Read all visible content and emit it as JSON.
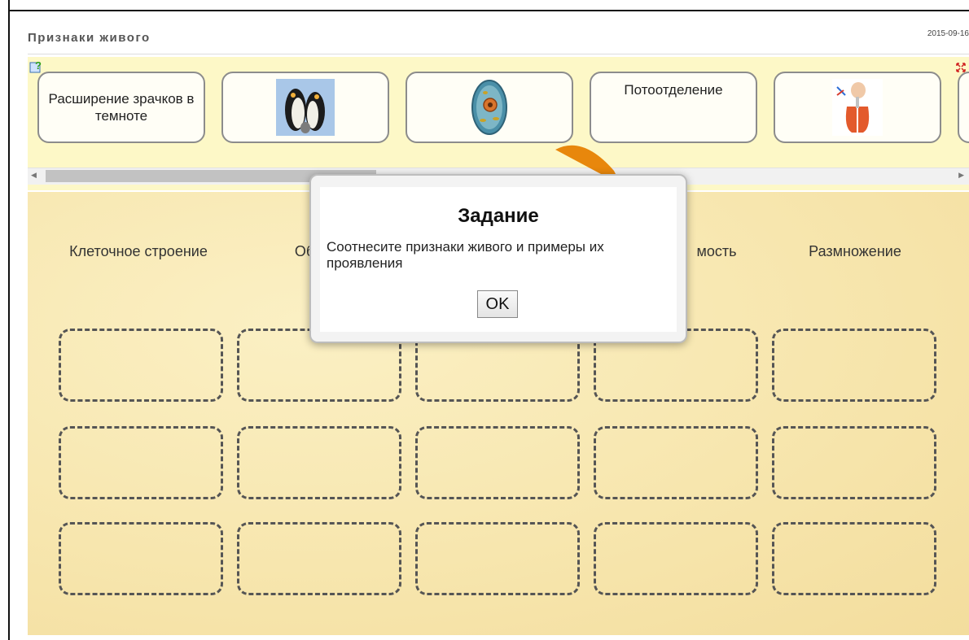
{
  "header": {
    "title": "Признаки живого",
    "date": "2015-09-16"
  },
  "tray": {
    "cards": [
      {
        "kind": "text",
        "label": "Расширение зрачков в темноте",
        "icon": ""
      },
      {
        "kind": "image",
        "label": "",
        "icon": "penguins-image"
      },
      {
        "kind": "image",
        "label": "",
        "icon": "cell-image"
      },
      {
        "kind": "text",
        "label": "Потоотделение",
        "icon": ""
      },
      {
        "kind": "image",
        "label": "",
        "icon": "lungs-image"
      }
    ]
  },
  "board": {
    "categories": [
      "Клеточное строение",
      "Обмен",
      "",
      "мость",
      "Размножение"
    ]
  },
  "modal": {
    "title": "Задание",
    "text": "Соотнесите признаки живого и примеры их проявления",
    "ok_label": "OK"
  },
  "colors": {
    "tray_bg": "#fdf8c7",
    "board_bg": "#f7e6ae",
    "accent_arrow": "#e8870c"
  }
}
